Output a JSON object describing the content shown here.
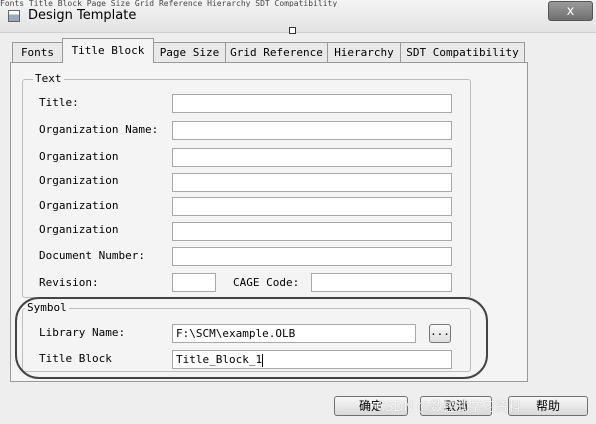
{
  "window": {
    "title": "Design Template",
    "background_strip": "Fonts Title Block Page Size Grid Reference Hierarchy SDT Compatibility",
    "close_label": "x"
  },
  "tabs": [
    {
      "label": "Fonts",
      "active": false
    },
    {
      "label": "Title Block",
      "active": true
    },
    {
      "label": "Page Size",
      "active": false
    },
    {
      "label": "Grid Reference",
      "active": false
    },
    {
      "label": "Hierarchy",
      "active": false
    },
    {
      "label": "SDT Compatibility",
      "active": false
    }
  ],
  "text_group": {
    "title": "Text",
    "title_label": "Title:",
    "organization_name_label": "Organization Name:",
    "organization_address_labels": [
      "Organization",
      "Organization",
      "Organization",
      "Organization"
    ],
    "document_number_label": "Document Number:",
    "revision_label": "Revision:",
    "cage_code_label": "CAGE Code:",
    "values": {
      "title": "",
      "organization_name": "",
      "organization_address": [
        "",
        "",
        "",
        ""
      ],
      "document_number": "",
      "revision": "",
      "cage_code": ""
    }
  },
  "symbol_group": {
    "title": "Symbol",
    "library_name_label": "Library Name:",
    "library_name_value": "F:\\SCM\\example.OLB",
    "browse_label": "...",
    "title_block_label": "Title Block",
    "title_block_value": "Title_Block_1"
  },
  "buttons": {
    "ok": "确定",
    "cancel": "取消",
    "help": "帮助"
  },
  "watermark": "CSDN @数控式学习资料"
}
